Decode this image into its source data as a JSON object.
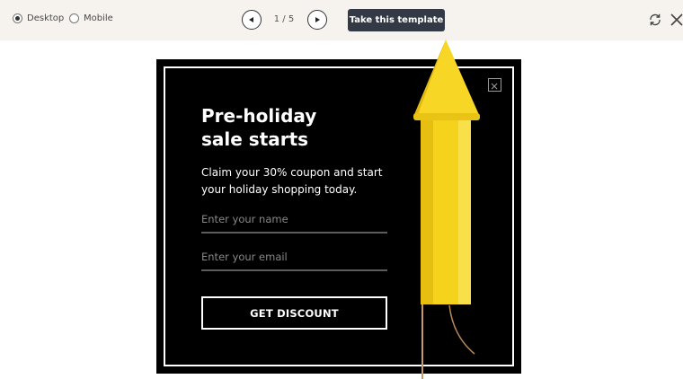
{
  "toolbar": {
    "view_options": [
      {
        "label": "Desktop",
        "selected": true
      },
      {
        "label": "Mobile",
        "selected": false
      }
    ],
    "pagination": {
      "current": 1,
      "total": 5,
      "label": "1 / 5"
    },
    "take_template_label": "Take this template",
    "icons": {
      "prev": "triangle-left-icon",
      "next": "triangle-right-icon",
      "refresh": "refresh-icon",
      "close": "close-icon"
    }
  },
  "popup": {
    "headline_line1": "Pre-holiday",
    "headline_line2": "sale starts",
    "subtext": "Claim your 30% coupon and start your holiday shopping today.",
    "name_placeholder": "Enter your name",
    "email_placeholder": "Enter your email",
    "cta_label": "GET DISCOUNT",
    "close_icon": "close-icon",
    "image": "yellow-firework-rocket",
    "colors": {
      "background": "#000000",
      "text": "#ffffff",
      "rocket": "#f5d21c",
      "button_dark": "#333a46"
    }
  }
}
